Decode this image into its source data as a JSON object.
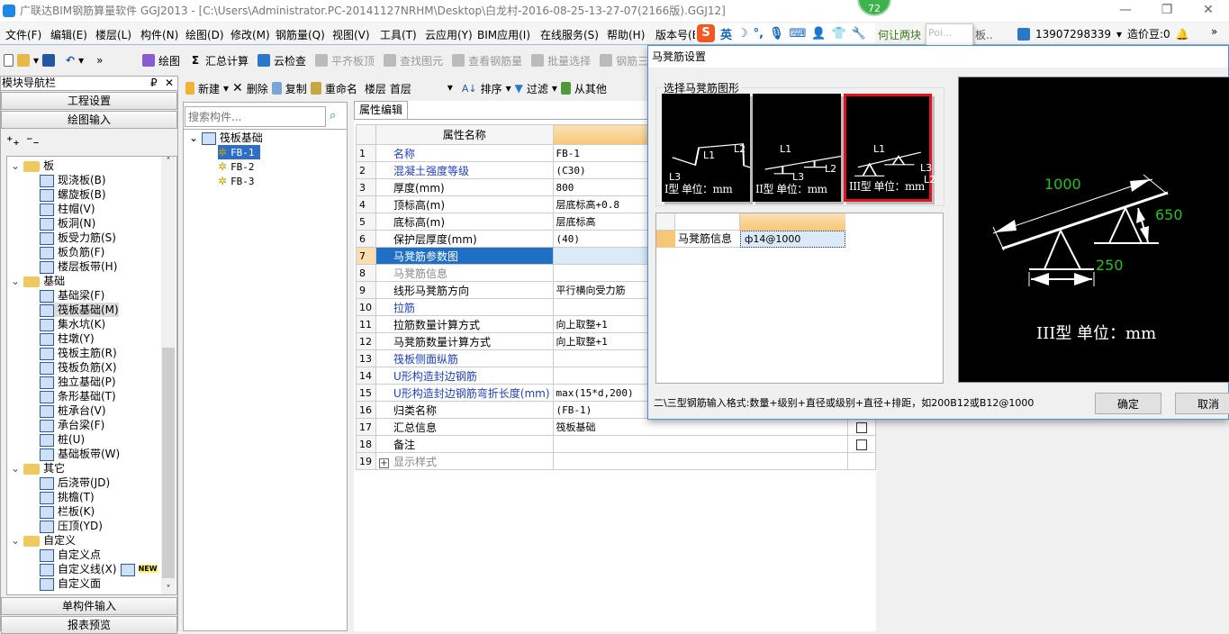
{
  "window": {
    "title": "广联达BIM钢筋算量软件 GGJ2013 - [C:\\Users\\Administrator.PC-20141127NRHM\\Desktop\\白龙村-2016-08-25-13-27-07(2166版).GGJ12]",
    "minimize": "—",
    "restore": "❐",
    "close": "✕",
    "badge": "72"
  },
  "menu": [
    "文件(F)",
    "编辑(E)",
    "楼层(L)",
    "构件(N)",
    "绘图(D)",
    "修改(M)",
    "钢筋量(Q)",
    "视图(V)",
    "工具(T)",
    "云应用(Y)",
    "BIM应用(I)",
    "在线服务(S)",
    "帮助(H)",
    "版本号(B)"
  ],
  "ime": {
    "logo": "S",
    "lang": "英"
  },
  "news_text": "何让两块",
  "news_tail": "板..",
  "popup": {
    "text": "Poi...",
    "start": "开始"
  },
  "user": {
    "phone": "13907298339",
    "beans": "造价豆:0",
    "more": "»"
  },
  "toolbar1": {
    "more": "»",
    "items": [
      {
        "label": "绘图",
        "disabled": false
      },
      {
        "label": "汇总计算",
        "disabled": false
      },
      {
        "label": "云检查",
        "disabled": false
      },
      {
        "label": "平齐板顶",
        "disabled": true
      },
      {
        "label": "查找图元",
        "disabled": true
      },
      {
        "label": "查看钢筋量",
        "disabled": true
      },
      {
        "label": "批量选择",
        "disabled": true
      },
      {
        "label": "钢筋三",
        "disabled": true
      }
    ]
  },
  "nav": {
    "title": "模块导航栏",
    "pin": "₽",
    "close": "✕",
    "project_settings": "工程设置",
    "drawing_input": "绘图输入",
    "single_input": "单构件输入",
    "report": "报表预览",
    "new_badge": "NEW",
    "tree": [
      {
        "type": "group",
        "label": "板"
      },
      {
        "type": "item",
        "label": "现浇板(B)"
      },
      {
        "type": "item",
        "label": "螺旋板(B)"
      },
      {
        "type": "item",
        "label": "柱帽(V)"
      },
      {
        "type": "item",
        "label": "板洞(N)"
      },
      {
        "type": "item",
        "label": "板受力筋(S)"
      },
      {
        "type": "item",
        "label": "板负筋(F)"
      },
      {
        "type": "item",
        "label": "楼层板带(H)"
      },
      {
        "type": "group",
        "label": "基础"
      },
      {
        "type": "item",
        "label": "基础梁(F)"
      },
      {
        "type": "item",
        "label": "筏板基础(M)",
        "selected": true
      },
      {
        "type": "item",
        "label": "集水坑(K)"
      },
      {
        "type": "item",
        "label": "柱墩(Y)"
      },
      {
        "type": "item",
        "label": "筏板主筋(R)"
      },
      {
        "type": "item",
        "label": "筏板负筋(X)"
      },
      {
        "type": "item",
        "label": "独立基础(P)"
      },
      {
        "type": "item",
        "label": "条形基础(T)"
      },
      {
        "type": "item",
        "label": "桩承台(V)"
      },
      {
        "type": "item",
        "label": "承台梁(F)"
      },
      {
        "type": "item",
        "label": "桩(U)"
      },
      {
        "type": "item",
        "label": "基础板带(W)"
      },
      {
        "type": "group",
        "label": "其它"
      },
      {
        "type": "item",
        "label": "后浇带(JD)"
      },
      {
        "type": "item",
        "label": "挑檐(T)"
      },
      {
        "type": "item",
        "label": "栏板(K)"
      },
      {
        "type": "item",
        "label": "压顶(YD)"
      },
      {
        "type": "group",
        "label": "自定义"
      },
      {
        "type": "item",
        "label": "自定义点"
      },
      {
        "type": "item",
        "label": "自定义线(X)",
        "new": true
      },
      {
        "type": "item",
        "label": "自定义面"
      }
    ]
  },
  "toolbar2": {
    "new": "新建",
    "delete": "删除",
    "copy": "复制",
    "rename": "重命名",
    "floor_label": "楼层",
    "floor_value": "首层",
    "sort": "排序",
    "filter": "过滤",
    "from_other": "从其他"
  },
  "components": {
    "search_placeholder": "搜索构件...",
    "root": "筏板基础",
    "items": [
      "FB-1",
      "FB-2",
      "FB-3"
    ],
    "selected": "FB-1"
  },
  "properties": {
    "tab": "属性编辑",
    "header_name": "属性名称",
    "rows": [
      {
        "n": "1",
        "name": "名称",
        "value": "FB-1",
        "color": "blue"
      },
      {
        "n": "2",
        "name": "混凝土强度等级",
        "value": "(C30)",
        "color": "blue"
      },
      {
        "n": "3",
        "name": "厚度(mm)",
        "value": "800",
        "color": "black"
      },
      {
        "n": "4",
        "name": "顶标高(m)",
        "value": "层底标高+0.8",
        "color": "black"
      },
      {
        "n": "5",
        "name": "底标高(m)",
        "value": "层底标高",
        "color": "black"
      },
      {
        "n": "6",
        "name": "保护层厚度(mm)",
        "value": "(40)",
        "color": "black"
      },
      {
        "n": "7",
        "name": "马凳筋参数图",
        "value": "",
        "color": "selected"
      },
      {
        "n": "8",
        "name": "马凳筋信息",
        "value": "",
        "color": "gray"
      },
      {
        "n": "9",
        "name": "线形马凳筋方向",
        "value": "平行横向受力筋",
        "color": "black"
      },
      {
        "n": "10",
        "name": "拉筋",
        "value": "",
        "color": "blue"
      },
      {
        "n": "11",
        "name": "拉筋数量计算方式",
        "value": "向上取整+1",
        "color": "black"
      },
      {
        "n": "12",
        "name": "马凳筋数量计算方式",
        "value": "向上取整+1",
        "color": "black"
      },
      {
        "n": "13",
        "name": "筏板侧面纵筋",
        "value": "",
        "color": "blue"
      },
      {
        "n": "14",
        "name": "U形构造封边钢筋",
        "value": "",
        "color": "blue"
      },
      {
        "n": "15",
        "name": "U形构造封边钢筋弯折长度(mm)",
        "value": "max(15*d,200)",
        "color": "blue"
      },
      {
        "n": "16",
        "name": "归类名称",
        "value": "(FB-1)",
        "color": "black"
      },
      {
        "n": "17",
        "name": "汇总信息",
        "value": "筏板基础",
        "color": "black",
        "checkbox": true
      },
      {
        "n": "18",
        "name": "备注",
        "value": "",
        "color": "black",
        "checkbox": true
      },
      {
        "n": "19",
        "name": "显示样式",
        "value": "",
        "color": "gray",
        "expander": "+"
      }
    ]
  },
  "dialog": {
    "title": "马凳筋设置",
    "group_label": "选择马凳筋图形",
    "shapes": [
      {
        "caption": "I型 单位：mm",
        "l1": "L1",
        "l2": "L2",
        "l3": "L3"
      },
      {
        "caption": "II型 单位：mm",
        "l1": "L1",
        "l2": "L2",
        "l3": "L3"
      },
      {
        "caption": "III型 单位：mm",
        "l1": "L1",
        "l2": "L2",
        "l3": "L3",
        "selected": true
      }
    ],
    "grid_label": "马凳筋信息",
    "grid_value": "ф14@1000",
    "preview": {
      "l1": "1000",
      "l2": "250",
      "l3": "650",
      "caption": "III型 单位：mm",
      "dim_color": "#22c322"
    },
    "hint": "二\\三型钢筋输入格式:数量+级别+直径或级别+直径+排距，如200B12或B12@1000",
    "ok": "确定",
    "cancel": "取消"
  },
  "colors": {
    "accent_blue": "#1f6fc5",
    "selected_red": "#e0141e",
    "header_orange": "#f6c777"
  }
}
